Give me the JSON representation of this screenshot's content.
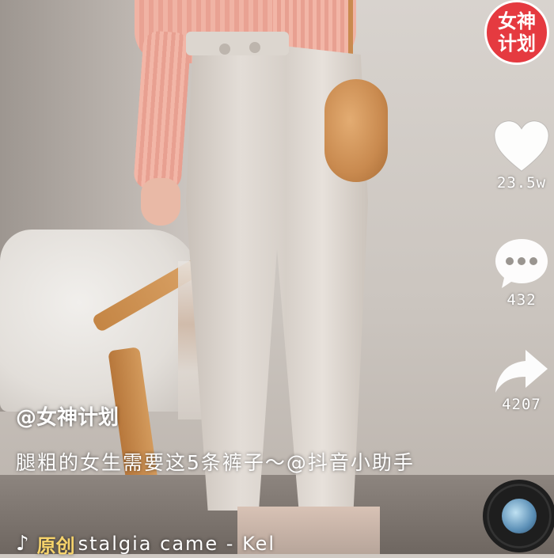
{
  "badge": {
    "line1": "女神",
    "line2": "计划"
  },
  "actions": {
    "like": {
      "icon": "heart-icon",
      "count": "23.5w"
    },
    "comment": {
      "icon": "comment-bubble-icon",
      "count": "432"
    },
    "share": {
      "icon": "share-arrow-icon",
      "count": "4207"
    }
  },
  "post": {
    "author": "@女神计划",
    "caption": "腿粗的女生需要这5条裤子～@抖音小助手"
  },
  "music": {
    "icon": "tiktok-note-icon",
    "original_label": "原创",
    "title": "stalgia came - Kel"
  },
  "colors": {
    "badge_red": "#e53a40",
    "original_yellow": "#f6d36b"
  }
}
